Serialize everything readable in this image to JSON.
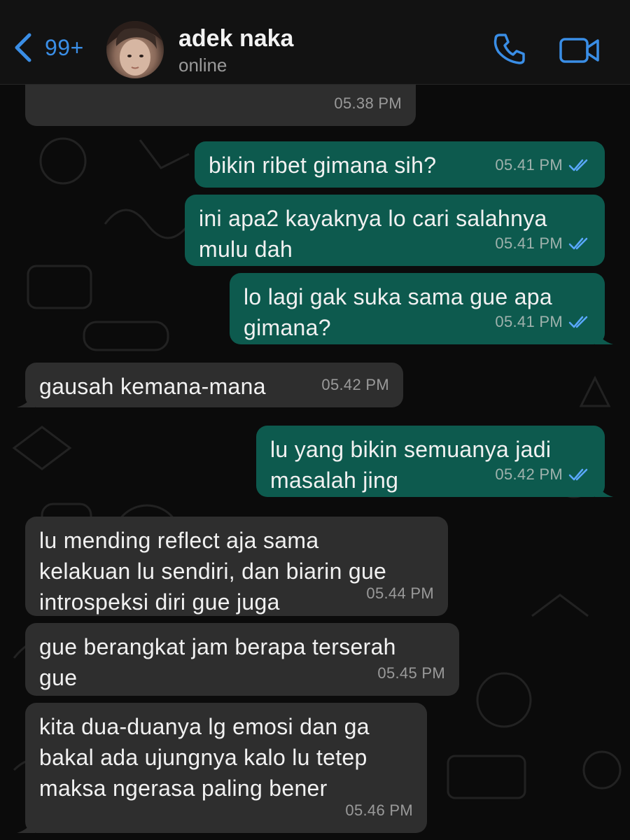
{
  "header": {
    "unread_count": "99+",
    "contact_name": "adek naka",
    "status": "online"
  },
  "colors": {
    "accent": "#3a8ee6",
    "incoming_bubble": "#2e2e2e",
    "outgoing_bubble": "#0d5a4e",
    "read_tick": "#5aa8ff"
  },
  "messages": [
    {
      "direction": "in",
      "text": "",
      "time": "05.38 PM"
    },
    {
      "direction": "out",
      "text": "bikin ribet gimana sih?",
      "time": "05.41 PM",
      "status": "read"
    },
    {
      "direction": "out",
      "text": "ini apa2 kayaknya lo cari salahnya\nmulu dah",
      "time": "05.41 PM",
      "status": "read"
    },
    {
      "direction": "out",
      "text": "lo lagi gak suka sama gue apa\ngimana?",
      "time": "05.41 PM",
      "status": "read"
    },
    {
      "direction": "in",
      "text": "gausah kemana-mana",
      "time": "05.42 PM"
    },
    {
      "direction": "out",
      "text": "lu yang bikin semuanya jadi\nmasalah jing",
      "time": "05.42 PM",
      "status": "read"
    },
    {
      "direction": "in",
      "text": "lu mending reflect aja sama\nkelakuan lu sendiri, dan biarin gue\nintrospeksi diri gue juga",
      "time": "05.44 PM"
    },
    {
      "direction": "in",
      "text": "gue berangkat jam berapa terserah\ngue",
      "time": "05.45 PM"
    },
    {
      "direction": "in",
      "text": "kita dua-duanya lg emosi dan ga\nbakal ada ujungnya kalo lu tetep\nmaksa ngerasa paling bener",
      "time": "05.46 PM"
    }
  ]
}
